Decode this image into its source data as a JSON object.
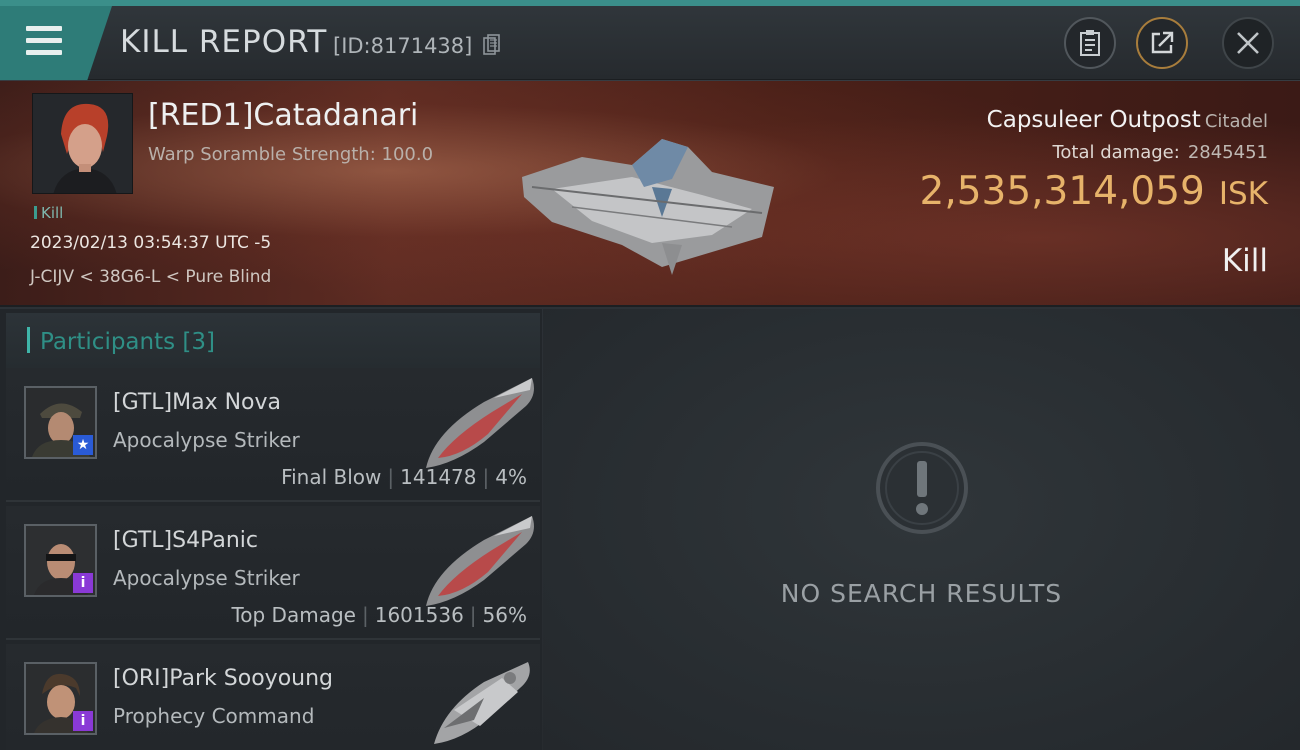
{
  "header": {
    "title": "KILL REPORT",
    "report_id": "[ID:8171438]",
    "icons": [
      "menu-icon",
      "copy-icon",
      "clipboard-icon",
      "share-icon",
      "close-icon"
    ]
  },
  "victim": {
    "name": "[RED1]Catadanari",
    "stat": "Warp Soramble Strength: 100.0",
    "result_tag": "Kill",
    "datetime": "2023/02/13 03:54:37 UTC -5",
    "location": "J-CIJV < 38G6-L < Pure Blind"
  },
  "target": {
    "name": "Capsuleer Outpost",
    "class": "Citadel",
    "total_damage_label": "Total damage:",
    "total_damage_value": "2845451",
    "isk_value": "2,535,314,059",
    "isk_unit": "ISK",
    "outcome": "Kill"
  },
  "participants": {
    "title": "Participants [3]",
    "items": [
      {
        "name": "[GTL]Max Nova",
        "ship": "Apocalypse Striker",
        "role": "Final Blow",
        "damage": "141478",
        "percent": "4%",
        "badge": "★",
        "badge_color": "#2a5bd6"
      },
      {
        "name": "[GTL]S4Panic",
        "ship": "Apocalypse Striker",
        "role": "Top Damage",
        "damage": "1601536",
        "percent": "56%",
        "badge": "i",
        "badge_color": "#8a39d6"
      },
      {
        "name": "[ORI]Park Sooyoung",
        "ship": "Prophecy Command",
        "role": "",
        "damage": "",
        "percent": "",
        "badge": "i",
        "badge_color": "#8a39d6"
      }
    ]
  },
  "results": {
    "empty_text": "NO SEARCH RESULTS",
    "icon": "exclamation-icon"
  },
  "colors": {
    "accent": "#2e7c78",
    "isk": "#e7b36a",
    "participants_title": "#2f8f86"
  }
}
